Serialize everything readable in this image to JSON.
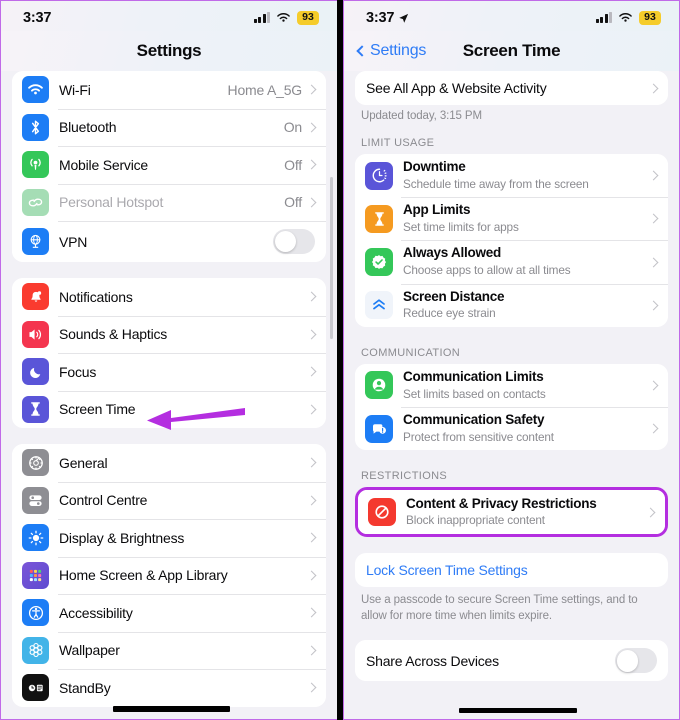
{
  "left_pane": {
    "status_bar": {
      "time": "3:37",
      "battery": "93",
      "signal_icon": "cellular-bars-icon",
      "wifi_icon": "wifi-icon",
      "battery_icon": "battery-low-power-badge"
    },
    "nav": {
      "title": "Settings"
    },
    "groups": [
      {
        "rows": [
          {
            "label": "Wi-Fi",
            "value": "Home A_5G",
            "icon": "wifi-icon",
            "icon_color": "#1d7df5",
            "accessory": "chevron"
          },
          {
            "label": "Bluetooth",
            "value": "On",
            "icon": "bluetooth-icon",
            "icon_color": "#1d7df5",
            "accessory": "chevron"
          },
          {
            "label": "Mobile Service",
            "value": "Off",
            "icon": "cellular-antenna-icon",
            "icon_color": "#34c759",
            "accessory": "chevron"
          },
          {
            "label": "Personal Hotspot",
            "value": "Off",
            "icon": "hotspot-link-icon",
            "icon_color": "#a5ddb5",
            "accessory": "chevron",
            "dimmed": true
          },
          {
            "label": "VPN",
            "value": "",
            "icon": "vpn-globe-icon",
            "icon_color": "#1d7df5",
            "accessory": "toggle",
            "toggle_on": false
          }
        ]
      },
      {
        "rows": [
          {
            "label": "Notifications",
            "value": "",
            "icon": "notification-bell-icon",
            "icon_color": "#fa3b2f",
            "accessory": "chevron"
          },
          {
            "label": "Sounds & Haptics",
            "value": "",
            "icon": "speaker-sound-icon",
            "icon_color": "#f4354f",
            "accessory": "chevron"
          },
          {
            "label": "Focus",
            "value": "",
            "icon": "focus-moon-icon",
            "icon_color": "#5a55d8",
            "accessory": "chevron"
          },
          {
            "label": "Screen Time",
            "value": "",
            "icon": "hourglass-icon",
            "icon_color": "#5a55d8",
            "accessory": "chevron"
          }
        ]
      },
      {
        "rows": [
          {
            "label": "General",
            "value": "",
            "icon": "gear-icon",
            "icon_color": "#8e8e93",
            "accessory": "chevron"
          },
          {
            "label": "Control Centre",
            "value": "",
            "icon": "control-centre-sliders-icon",
            "icon_color": "#8e8e93",
            "accessory": "chevron"
          },
          {
            "label": "Display & Brightness",
            "value": "",
            "icon": "brightness-sun-icon",
            "icon_color": "#1d7df5",
            "accessory": "chevron"
          },
          {
            "label": "Home Screen & App Library",
            "value": "",
            "icon": "app-grid-icon",
            "icon_color": "#7a55d8",
            "accessory": "chevron"
          },
          {
            "label": "Accessibility",
            "value": "",
            "icon": "accessibility-person-icon",
            "icon_color": "#1d7df5",
            "accessory": "chevron"
          },
          {
            "label": "Wallpaper",
            "value": "",
            "icon": "wallpaper-flower-icon",
            "icon_color": "#42b4e8",
            "accessory": "chevron"
          },
          {
            "label": "StandBy",
            "value": "",
            "icon": "standby-clock-icon",
            "icon_color": "#111111",
            "accessory": "chevron"
          }
        ]
      }
    ],
    "annotation": {
      "arrow_color": "#b42ee0",
      "points_to": "Screen Time"
    }
  },
  "right_pane": {
    "status_bar": {
      "time": "3:37",
      "battery": "93",
      "location_icon": "location-arrow-icon",
      "signal_icon": "cellular-bars-icon",
      "wifi_icon": "wifi-icon"
    },
    "nav": {
      "back_label": "Settings",
      "title": "Screen Time",
      "back_icon": "chevron-left-icon"
    },
    "activity_row": {
      "label": "See All App & Website Activity",
      "accessory": "chevron"
    },
    "updated_text": "Updated today, 3:15 PM",
    "sections": [
      {
        "header": "LIMIT USAGE",
        "rows": [
          {
            "title": "Downtime",
            "subtitle": "Schedule time away from the screen",
            "icon": "downtime-clock-icon",
            "icon_color": "#5a55d8"
          },
          {
            "title": "App Limits",
            "subtitle": "Set time limits for apps",
            "icon": "hourglass-icon",
            "icon_color": "#f59a20"
          },
          {
            "title": "Always Allowed",
            "subtitle": "Choose apps to allow at all times",
            "icon": "checkmark-seal-icon",
            "icon_color": "#34c759"
          },
          {
            "title": "Screen Distance",
            "subtitle": "Reduce eye strain",
            "icon": "screen-distance-chevrons-icon",
            "icon_color": "#f2f5fa"
          }
        ]
      },
      {
        "header": "COMMUNICATION",
        "rows": [
          {
            "title": "Communication Limits",
            "subtitle": "Set limits based on contacts",
            "icon": "person-circle-icon",
            "icon_color": "#34c759"
          },
          {
            "title": "Communication Safety",
            "subtitle": "Protect from sensitive content",
            "icon": "message-shield-icon",
            "icon_color": "#1d7df5"
          }
        ]
      },
      {
        "header": "RESTRICTIONS",
        "highlighted": true,
        "rows": [
          {
            "title": "Content & Privacy Restrictions",
            "subtitle": "Block inappropriate content",
            "icon": "no-entry-icon",
            "icon_color": "#f4392f"
          }
        ]
      }
    ],
    "lock_row": {
      "label": "Lock Screen Time Settings"
    },
    "lock_footer": "Use a passcode to secure Screen Time settings, and to allow for more time when limits expire.",
    "share_row": {
      "label": "Share Across Devices",
      "toggle_on": false
    },
    "highlight_color": "#b42ee0"
  }
}
